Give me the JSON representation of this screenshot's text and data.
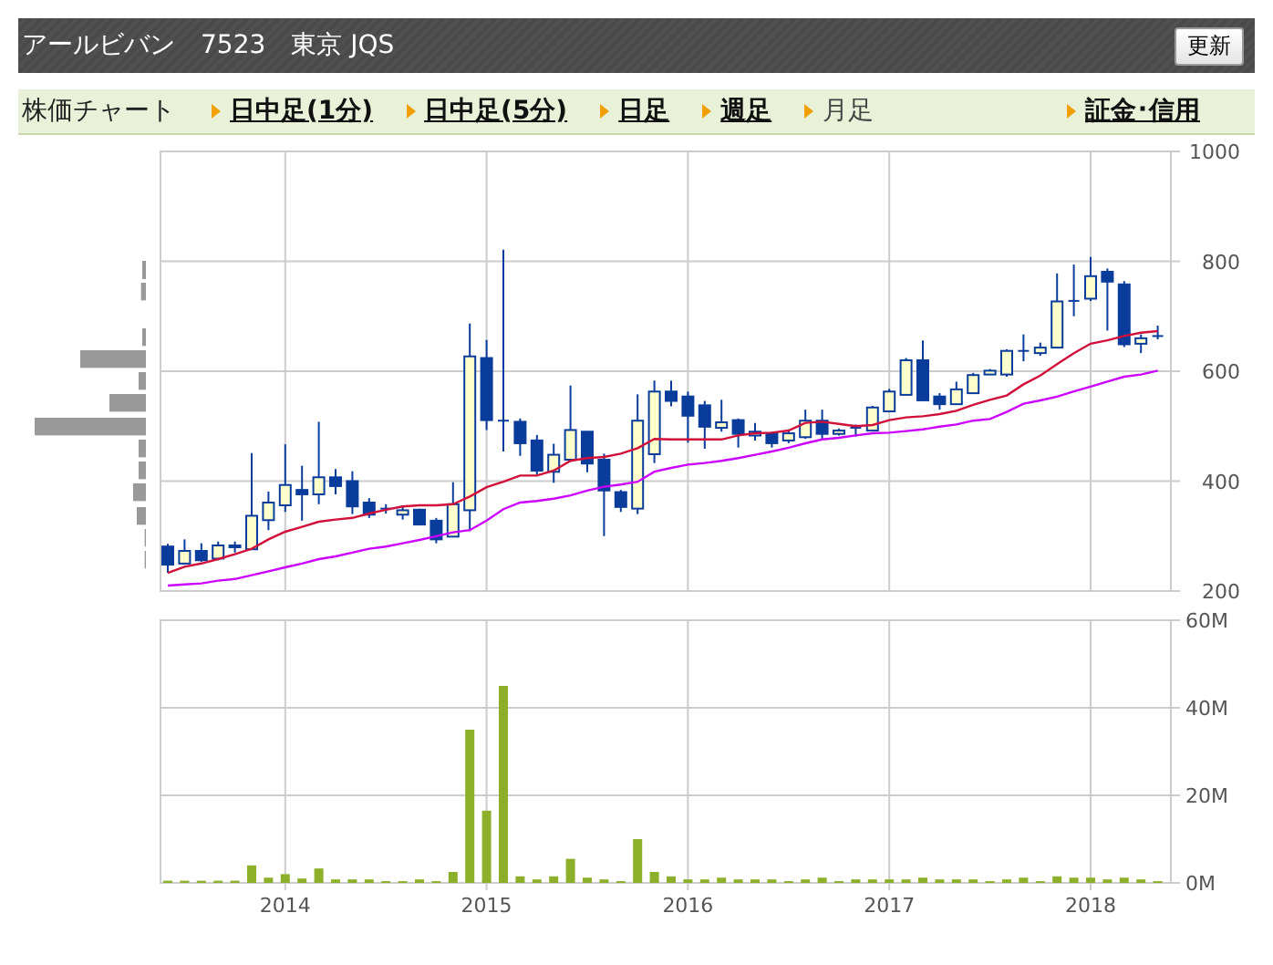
{
  "header": {
    "name": "アールビバン",
    "code": "7523",
    "market": "東京 JQS",
    "refresh_button": "更新"
  },
  "nav": {
    "title": "株価チャート",
    "tabs": [
      {
        "label": "日中足(1分)",
        "selected": false
      },
      {
        "label": "日中足(5分)",
        "selected": false
      },
      {
        "label": "日足",
        "selected": false
      },
      {
        "label": "週足",
        "selected": false
      },
      {
        "label": "月足",
        "selected": true
      }
    ],
    "link": "証金･信用"
  },
  "price_chart": {
    "chart_data": {
      "type": "candlestick",
      "categories": [
        null,
        null,
        null,
        null,
        null,
        null,
        null,
        null,
        null,
        null,
        null,
        null,
        null,
        null,
        null,
        null,
        null,
        null,
        null,
        null,
        null,
        null,
        null,
        null,
        null,
        null,
        null,
        null,
        null,
        null,
        null,
        null,
        null,
        null,
        null,
        null,
        null,
        null,
        null,
        null,
        null,
        null,
        null,
        null,
        null,
        null,
        null,
        null,
        null,
        null,
        null,
        null,
        null,
        null,
        null,
        null,
        null,
        null,
        null,
        null
      ],
      "ohlc": [
        [
          281,
          286,
          233,
          248
        ],
        [
          250,
          294,
          248,
          273
        ],
        [
          273,
          287,
          253,
          256
        ],
        [
          259,
          290,
          256,
          283
        ],
        [
          282,
          290,
          270,
          283
        ],
        [
          276,
          451,
          276,
          337
        ],
        [
          329,
          381,
          311,
          361
        ],
        [
          356,
          467,
          344,
          393
        ],
        [
          384,
          428,
          328,
          376
        ],
        [
          376,
          508,
          358,
          407
        ],
        [
          407,
          422,
          376,
          391
        ],
        [
          400,
          418,
          340,
          354
        ],
        [
          361,
          369,
          333,
          339
        ],
        [
          350,
          358,
          341,
          350
        ],
        [
          339,
          356,
          330,
          347
        ],
        [
          348,
          350,
          321,
          321
        ],
        [
          328,
          333,
          287,
          294
        ],
        [
          299,
          398,
          299,
          358
        ],
        [
          347,
          687,
          309,
          627
        ],
        [
          624,
          657,
          493,
          511
        ],
        [
          510,
          821,
          454,
          510
        ],
        [
          508,
          514,
          446,
          469
        ],
        [
          474,
          484,
          412,
          419
        ],
        [
          417,
          468,
          397,
          448
        ],
        [
          439,
          574,
          439,
          493
        ],
        [
          490,
          490,
          416,
          432
        ],
        [
          439,
          450,
          300,
          383
        ],
        [
          380,
          384,
          344,
          353
        ],
        [
          350,
          558,
          340,
          510
        ],
        [
          449,
          583,
          433,
          563
        ],
        [
          563,
          583,
          536,
          546
        ],
        [
          554,
          563,
          470,
          519
        ],
        [
          538,
          546,
          459,
          499
        ],
        [
          497,
          548,
          490,
          507
        ],
        [
          511,
          514,
          461,
          486
        ],
        [
          483,
          506,
          474,
          490
        ],
        [
          487,
          490,
          461,
          469
        ],
        [
          474,
          494,
          469,
          487
        ],
        [
          480,
          530,
          477,
          510
        ],
        [
          510,
          530,
          477,
          486
        ],
        [
          486,
          496,
          483,
          492
        ],
        [
          497,
          503,
          481,
          497
        ],
        [
          492,
          537,
          492,
          534
        ],
        [
          527,
          568,
          527,
          563
        ],
        [
          557,
          624,
          557,
          620
        ],
        [
          620,
          656,
          547,
          547
        ],
        [
          554,
          560,
          530,
          540
        ],
        [
          540,
          581,
          540,
          567
        ],
        [
          560,
          597,
          560,
          593
        ],
        [
          594,
          604,
          594,
          601
        ],
        [
          594,
          640,
          590,
          637
        ],
        [
          637,
          667,
          618,
          637
        ],
        [
          633,
          652,
          628,
          643
        ],
        [
          643,
          778,
          643,
          727
        ],
        [
          728,
          794,
          700,
          728
        ],
        [
          732,
          808,
          728,
          773
        ],
        [
          781,
          787,
          674,
          763
        ],
        [
          758,
          764,
          644,
          649
        ],
        [
          650,
          667,
          633,
          660
        ],
        [
          664,
          683,
          658,
          664
        ]
      ],
      "ylim": [
        200,
        1000
      ],
      "yticks": [
        200,
        400,
        600,
        800,
        1000
      ],
      "grid": true
    }
  },
  "moving_average_chart": {
    "chart_data": {
      "type": "line",
      "categories": [
        null,
        null,
        null,
        null,
        null,
        null,
        null,
        null,
        null,
        null,
        null,
        null,
        null,
        null,
        null,
        null,
        null,
        null,
        null,
        null,
        null,
        null,
        null,
        null,
        null,
        null,
        null,
        null,
        null,
        null,
        null,
        null,
        null,
        null,
        null,
        null,
        null,
        null,
        null,
        null,
        null,
        null,
        null,
        null,
        null,
        null,
        null,
        null,
        null,
        null,
        null,
        null,
        null,
        null,
        null,
        null,
        null,
        null,
        null,
        null
      ],
      "series": [
        {
          "color": "#d0103a",
          "values": [
            233,
            244,
            250,
            258,
            267,
            277,
            294,
            308,
            317,
            326,
            330,
            333,
            341,
            348,
            354,
            356,
            356,
            358,
            372,
            389,
            399,
            410,
            410,
            419,
            437,
            442,
            444,
            450,
            460,
            477,
            476,
            476,
            476,
            476,
            483,
            487,
            488,
            492,
            506,
            508,
            504,
            500,
            502,
            511,
            516,
            518,
            522,
            528,
            539,
            548,
            556,
            576,
            592,
            613,
            633,
            650,
            656,
            664,
            670,
            673
          ]
        },
        {
          "color": "#cc00ff",
          "values": [
            210,
            212,
            214,
            219,
            222,
            229,
            236,
            243,
            250,
            258,
            263,
            270,
            277,
            281,
            287,
            293,
            300,
            307,
            311,
            328,
            349,
            361,
            364,
            368,
            374,
            383,
            390,
            394,
            399,
            417,
            424,
            430,
            433,
            437,
            442,
            448,
            454,
            461,
            469,
            476,
            479,
            483,
            487,
            488,
            491,
            494,
            499,
            503,
            510,
            513,
            526,
            541,
            547,
            554,
            563,
            572,
            581,
            590,
            594,
            601
          ]
        }
      ],
      "ylim": [
        200,
        1000
      ]
    }
  },
  "volume_chart": {
    "chart_data": {
      "type": "bar",
      "categories": [
        null,
        null,
        null,
        null,
        null,
        null,
        null,
        "2014",
        null,
        null,
        null,
        null,
        null,
        null,
        null,
        null,
        null,
        null,
        null,
        "2015",
        null,
        null,
        null,
        null,
        null,
        null,
        null,
        null,
        null,
        null,
        null,
        "2016",
        null,
        null,
        null,
        null,
        null,
        null,
        null,
        null,
        null,
        null,
        null,
        "2017",
        null,
        null,
        null,
        null,
        null,
        null,
        null,
        null,
        null,
        null,
        null,
        "2018",
        null,
        null,
        null,
        null
      ],
      "series": [
        {
          "color": "#8cb02a",
          "values": [
            0.5,
            0.5,
            0.5,
            0.5,
            0.5,
            4,
            1.2,
            2,
            1,
            3.3,
            0.8,
            0.8,
            0.8,
            0.4,
            0.4,
            0.8,
            0.4,
            2.5,
            35,
            16.5,
            45,
            1.5,
            0.8,
            1.5,
            5.5,
            1.2,
            0.8,
            0.4,
            10,
            2.5,
            1.5,
            0.8,
            0.8,
            1.2,
            0.8,
            0.8,
            0.8,
            0.4,
            0.8,
            1.2,
            0.4,
            0.8,
            0.8,
            0.8,
            0.8,
            1.2,
            0.8,
            0.8,
            0.8,
            0.4,
            0.8,
            1.2,
            0.4,
            1.5,
            1.2,
            1.2,
            0.8,
            1.2,
            0.8,
            0.4
          ]
        }
      ],
      "ylim": [
        0,
        60
      ],
      "yticks": [
        {
          "value": 0,
          "label": "0M"
        },
        {
          "value": 20,
          "label": "20M"
        },
        {
          "value": 40,
          "label": "40M"
        },
        {
          "value": 60,
          "label": "60M"
        }
      ],
      "grid": true
    }
  }
}
